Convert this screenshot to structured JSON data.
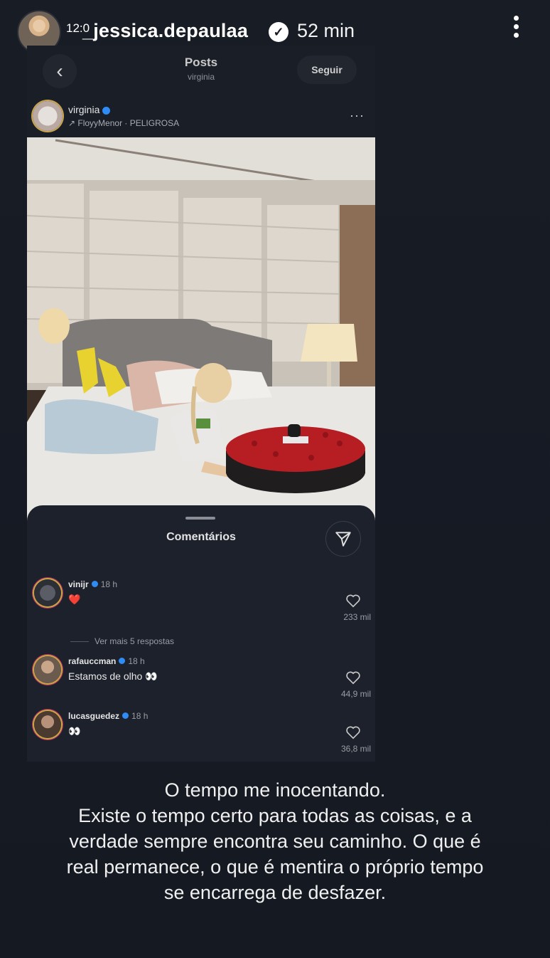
{
  "story": {
    "username": "_jessica.depaulaa",
    "overlap_time": "12:0",
    "timestamp": "52 min"
  },
  "screenshot": {
    "nav": {
      "title": "Posts",
      "subtitle": "virginia",
      "follow_label": "Seguir"
    },
    "post": {
      "username": "virginia",
      "music": "FloyyMenor · PELIGROSA",
      "more": "···"
    },
    "comments": {
      "title": "Comentários",
      "more_replies": "Ver mais 5 respostas",
      "items": [
        {
          "username": "vinijr",
          "time": "18 h",
          "text": "❤️",
          "likes": "233 mil"
        },
        {
          "username": "rafauccman",
          "time": "18 h",
          "text": "Estamos de olho 👀",
          "likes": "44,9 mil"
        },
        {
          "username": "lucasguedez",
          "time": "18 h",
          "text": "👀",
          "likes": "36,8 mil"
        }
      ]
    }
  },
  "caption": {
    "lines": [
      "O tempo me inocentando.",
      "Existe o tempo certo para todas as coisas, e a",
      "verdade sempre encontra seu caminho. O que é",
      "real permanece, o que é mentira o próprio tempo",
      "se encarrega de desfazer."
    ]
  },
  "icons": {
    "back": "chevron-left-icon",
    "share": "paper-plane-icon",
    "like": "heart-icon",
    "options": "more-vertical-icon"
  },
  "colors": {
    "background": "#161a22",
    "verified": "#2f8cf5",
    "story_ring": "#c8a640"
  }
}
